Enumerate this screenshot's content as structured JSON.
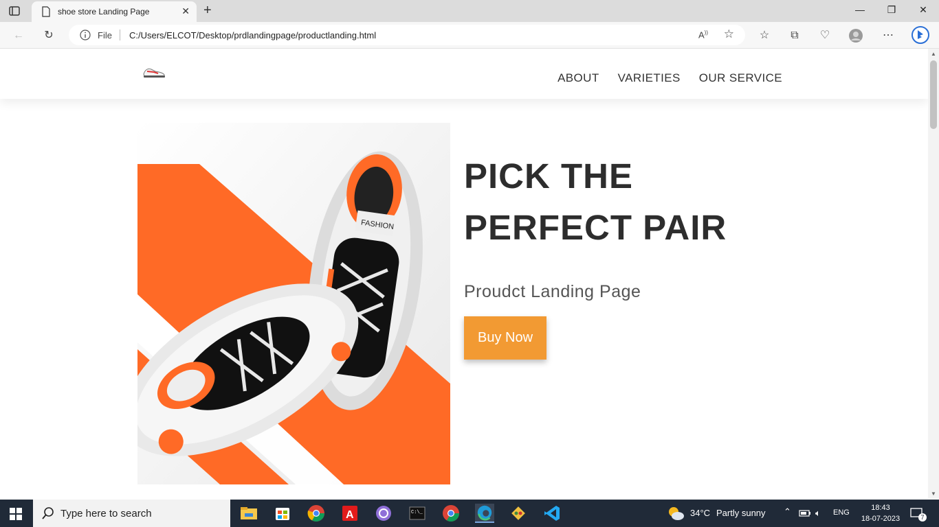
{
  "browser": {
    "tab_title": "shoe store Landing Page",
    "file_label": "File",
    "url": "C:/Users/ELCOT/Desktop/prdlandingpage/productlanding.html"
  },
  "nav": {
    "links": [
      "ABOUT",
      "VARIETIES",
      "OUR SERVICE"
    ]
  },
  "hero": {
    "title_line1": "PICK THE",
    "title_line2": "PERFECT PAIR",
    "subtitle": "Proudct Landing Page",
    "button": "Buy Now",
    "accent_color": "#f29a33",
    "shoe_text": "FASHION"
  },
  "taskbar": {
    "search_placeholder": "Type here to search",
    "weather_temp": "34°C",
    "weather_desc": "Partly sunny",
    "lang": "ENG",
    "time": "18:43",
    "date": "18-07-2023",
    "notif_count": "7"
  }
}
